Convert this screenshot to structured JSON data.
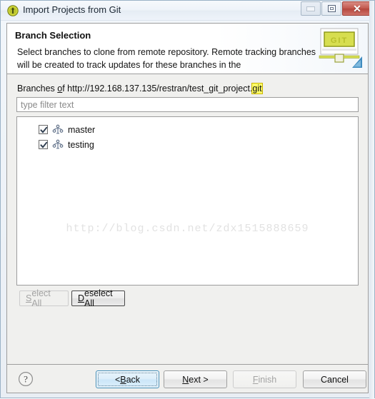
{
  "window": {
    "title": "Import Projects from Git",
    "icon": "git-app-icon",
    "buttons": {
      "minimize": "minimize-icon",
      "maximize": "restore-icon",
      "close": "✕"
    }
  },
  "header": {
    "title": "Branch Selection",
    "description": "Select branches to clone from remote repository. Remote tracking branches will be created to track updates for these branches in the",
    "banner_icon": "git-monitor-banner",
    "banner_text": "GIT"
  },
  "branches_section": {
    "label_prefix": "Branches ",
    "label_accelerator": "o",
    "label_middle": "f http://192.168.137.135/restran/test_git_project.",
    "label_highlight": "git",
    "repository_url": "http://192.168.137.135/restran/test_git_project.git",
    "filter": {
      "value": "",
      "placeholder": "type filter text"
    },
    "items": [
      {
        "name": "master",
        "checked": true,
        "icon": "git-branch-icon"
      },
      {
        "name": "testing",
        "checked": true,
        "icon": "git-branch-icon"
      }
    ],
    "watermark": "http://blog.csdn.net/zdx1515888659",
    "select_all": {
      "prefix": "",
      "accelerator": "S",
      "suffix": "elect All",
      "enabled": false
    },
    "deselect_all": {
      "prefix": "",
      "accelerator": "D",
      "suffix": "eselect All",
      "enabled": true,
      "focused": true
    }
  },
  "footer": {
    "help_icon": "help-question-icon",
    "buttons": [
      {
        "prefix": "< ",
        "accelerator": "B",
        "suffix": "ack",
        "enabled": true,
        "focused": true
      },
      {
        "prefix": "",
        "accelerator": "N",
        "suffix": "ext >",
        "enabled": true,
        "focused": false
      },
      {
        "prefix": "",
        "accelerator": "F",
        "suffix": "inish",
        "enabled": false,
        "focused": false
      },
      {
        "prefix": "",
        "accelerator": "",
        "suffix": "Cancel",
        "enabled": true,
        "focused": false
      }
    ]
  },
  "colors": {
    "dialog_bg": "#f0f0ee",
    "header_bg": "#ffffff",
    "accent_focus": "#3c8ab5",
    "highlight_yellow": "#ffff66",
    "close_red": "#c2564c",
    "watermark_gray": "#e2e2e2"
  }
}
